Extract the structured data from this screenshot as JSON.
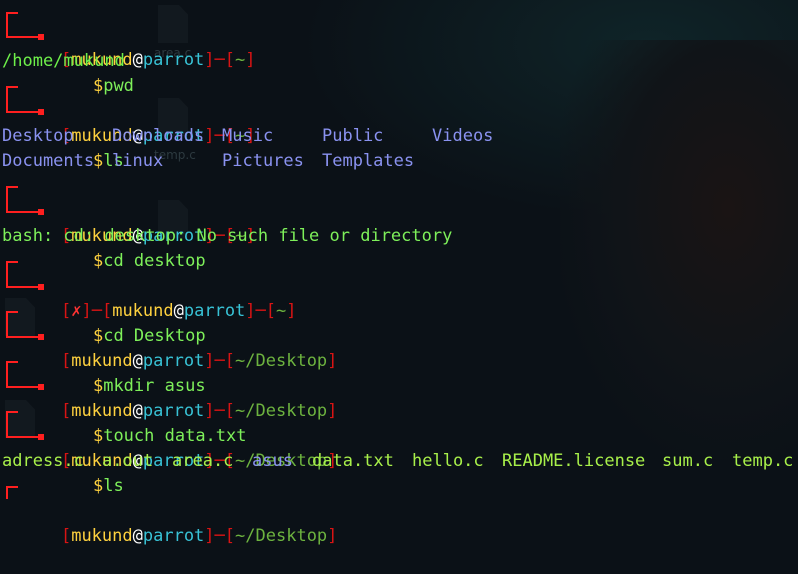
{
  "prompt": {
    "user": "mukund",
    "at": "@",
    "host": "parrot",
    "open": "[",
    "close": "]",
    "dash": "─",
    "err_mark": "✗",
    "dollar": "$"
  },
  "paths": {
    "home": "~",
    "desktop": "~/Desktop"
  },
  "commands": {
    "pwd": "pwd",
    "ls": "ls",
    "cd_lower": "cd desktop",
    "cd_upper": "cd Desktop",
    "mkdir": "mkdir asus",
    "touch": "touch data.txt",
    "ls2": "ls"
  },
  "outputs": {
    "pwd": "/home/mukund",
    "ls_row1": [
      "Desktop",
      "Downloads",
      "Music",
      "Public",
      "Videos"
    ],
    "ls_row2": [
      "Documents",
      "linux",
      "Pictures",
      "Templates"
    ],
    "cd_error": "bash: cd: desktop: No such file or directory",
    "ls2": [
      "adress.c",
      "a.out",
      "area.c",
      "asus",
      "data.txt",
      "hello.c",
      "README.license",
      "sum.c",
      "temp.c"
    ]
  },
  "background": {
    "desktop_icons": [
      "area.c",
      "temp.c"
    ]
  },
  "colors": {
    "background": "#0b1117",
    "bracket": "#d81414",
    "user": "#ffd23f",
    "host": "#38c3d6",
    "path": "#6db33f",
    "command": "#7ef05a",
    "directory": "#8a92f0"
  }
}
